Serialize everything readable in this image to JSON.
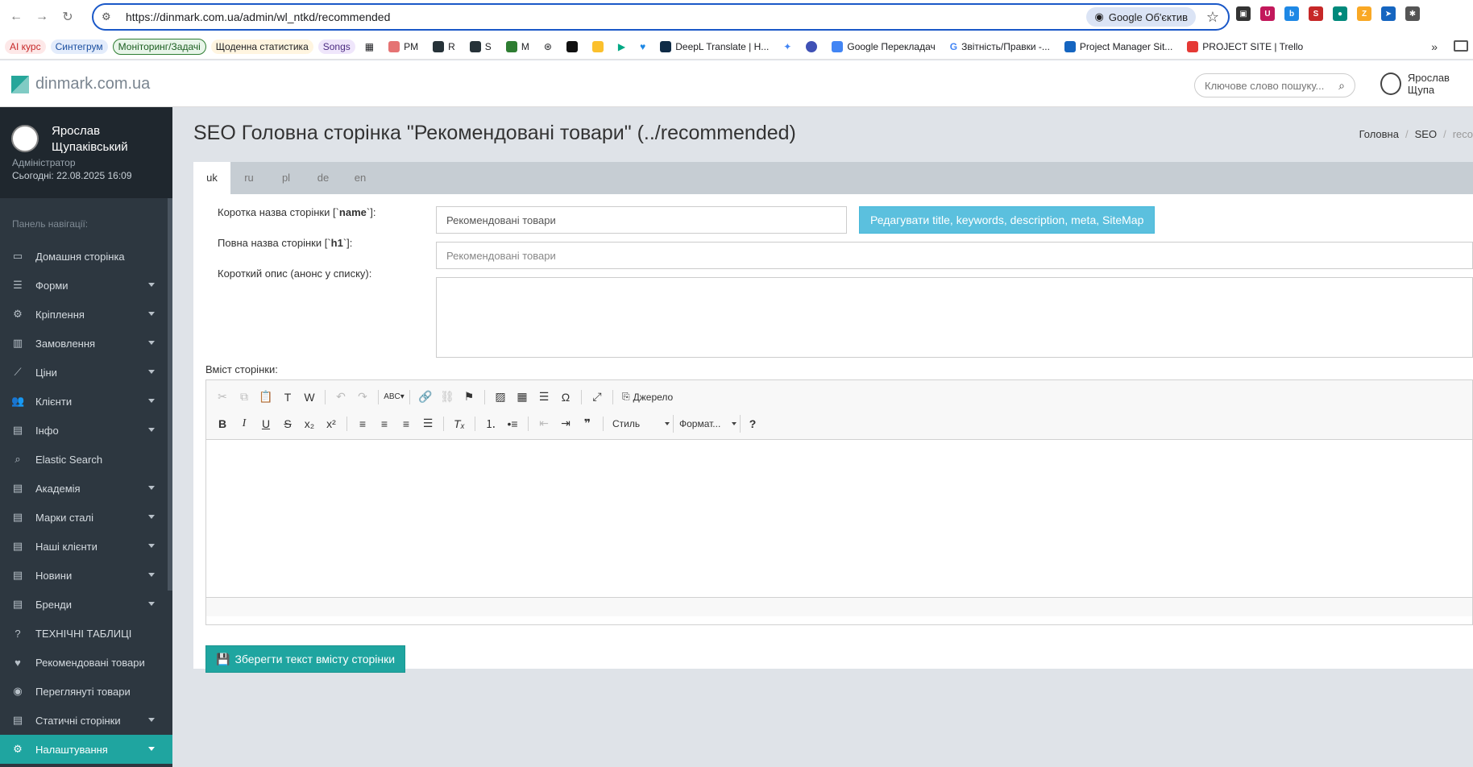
{
  "browser": {
    "url": "https://dinmark.com.ua/admin/wl_ntkd/recommended",
    "lens_chip": "Google Об'єктив"
  },
  "bookmarks": [
    {
      "label": "AI курс"
    },
    {
      "label": "Синтегрум"
    },
    {
      "label": "Моніторинг/Задачі"
    },
    {
      "label": "Щоденна статистика"
    },
    {
      "label": "Songs"
    },
    {
      "label": "PM"
    },
    {
      "label": "R"
    },
    {
      "label": "S"
    },
    {
      "label": "M"
    },
    {
      "label": "DeepL Translate | H..."
    },
    {
      "label": "Google Перекладач"
    },
    {
      "label": "Звітність/Правки -..."
    },
    {
      "label": "Project Manager Sit..."
    },
    {
      "label": "PROJECT SITE | Trello"
    }
  ],
  "header": {
    "logo_text": "dinmark.com.ua",
    "search_placeholder": "Ключове слово пошуку...",
    "user_name": "Ярослав Щупа"
  },
  "sidebar": {
    "user_full_name": "Ярослав Щупаківський",
    "role": "Адміністратор",
    "today": "Сьогодні: 22.08.2025 16:09",
    "nav_title": "Панель навігації:",
    "items": [
      {
        "label": "Домашня сторінка",
        "icon": "laptop-icon",
        "caret": false
      },
      {
        "label": "Форми",
        "icon": "list-icon",
        "caret": true
      },
      {
        "label": "Кріплення",
        "icon": "bicycle-icon",
        "caret": true
      },
      {
        "label": "Замовлення",
        "icon": "bar-chart-icon",
        "caret": true
      },
      {
        "label": "Ціни",
        "icon": "line-chart-icon",
        "caret": true
      },
      {
        "label": "Клієнти",
        "icon": "users-icon",
        "caret": true
      },
      {
        "label": "Інфо",
        "icon": "book-icon",
        "caret": true
      },
      {
        "label": "Elastic Search",
        "icon": "search-icon",
        "caret": false
      },
      {
        "label": "Академія",
        "icon": "book-icon",
        "caret": true
      },
      {
        "label": "Марки сталі",
        "icon": "book-icon",
        "caret": true
      },
      {
        "label": "Наші клієнти",
        "icon": "book-icon",
        "caret": true
      },
      {
        "label": "Новини",
        "icon": "book-icon",
        "caret": true
      },
      {
        "label": "Бренди",
        "icon": "book-icon",
        "caret": true
      },
      {
        "label": "ТЕХНІЧНІ ТАБЛИЦІ",
        "icon": "question-icon",
        "caret": false
      },
      {
        "label": "Рекомендовані товари",
        "icon": "heart-icon",
        "caret": false
      },
      {
        "label": "Переглянуті товари",
        "icon": "eye-icon",
        "caret": false
      },
      {
        "label": "Статичні сторінки",
        "icon": "book-icon",
        "caret": true
      },
      {
        "label": "Налаштування",
        "icon": "gears-icon",
        "caret": true,
        "active": true
      }
    ]
  },
  "main": {
    "title": "SEO Головна сторінка \"Рекомендовані товари\" (../recommended)",
    "breadcrumb": [
      "Головна",
      "SEO",
      "reco"
    ],
    "tabs": [
      "uk",
      "ru",
      "pl",
      "de",
      "en"
    ],
    "active_tab": "uk",
    "form": {
      "name_label_prefix": "Коротка назва сторінки [`",
      "name_label_key": "name",
      "name_label_suffix": "`]:",
      "name_value": "Рекомендовані товари",
      "h1_label_prefix": "Повна назва сторінки [`",
      "h1_label_key": "h1",
      "h1_label_suffix": "`]:",
      "h1_placeholder": "Рекомендовані товари",
      "desc_label": "Короткий опис (анонс у списку):",
      "desc_value": "",
      "seo_button": "Редагувати title, keywords, description, meta, SiteMap"
    },
    "editor": {
      "content_label": "Вміст сторінки:",
      "source_label": "Джерело",
      "style_combo": "Стиль",
      "format_combo": "Формат..."
    },
    "save_button": "Зберегти текст вмісту сторінки"
  },
  "colors": {
    "accent": "#1fa5a0",
    "info_button": "#5bc0de",
    "sidebar_bg": "#2d3740"
  }
}
